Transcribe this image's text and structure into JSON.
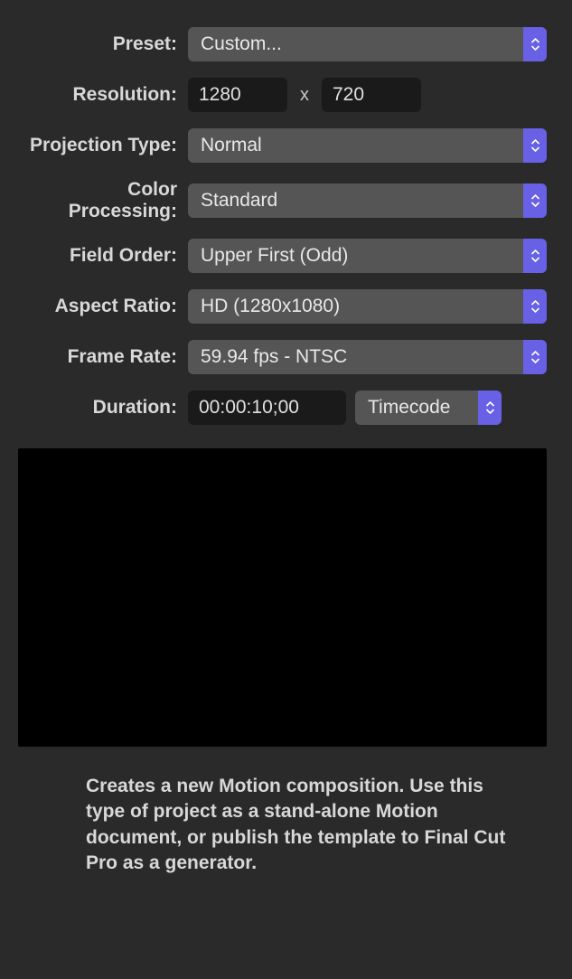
{
  "labels": {
    "preset": "Preset:",
    "resolution": "Resolution:",
    "projection": "Projection Type:",
    "color": "Color Processing:",
    "field": "Field Order:",
    "aspect": "Aspect Ratio:",
    "framerate": "Frame Rate:",
    "duration": "Duration:"
  },
  "values": {
    "preset": "Custom...",
    "res_w": "1280",
    "res_h": "720",
    "projection": "Normal",
    "color": "Standard",
    "field": "Upper First (Odd)",
    "aspect": "HD (1280x1080)",
    "framerate": "59.94 fps - NTSC",
    "duration": "00:00:10;00",
    "timemode": "Timecode"
  },
  "misc": {
    "x": "x"
  },
  "description": "Creates a new Motion composition. Use this type of project as a stand-alone Motion document, or publish the template to Final Cut Pro as a generator."
}
